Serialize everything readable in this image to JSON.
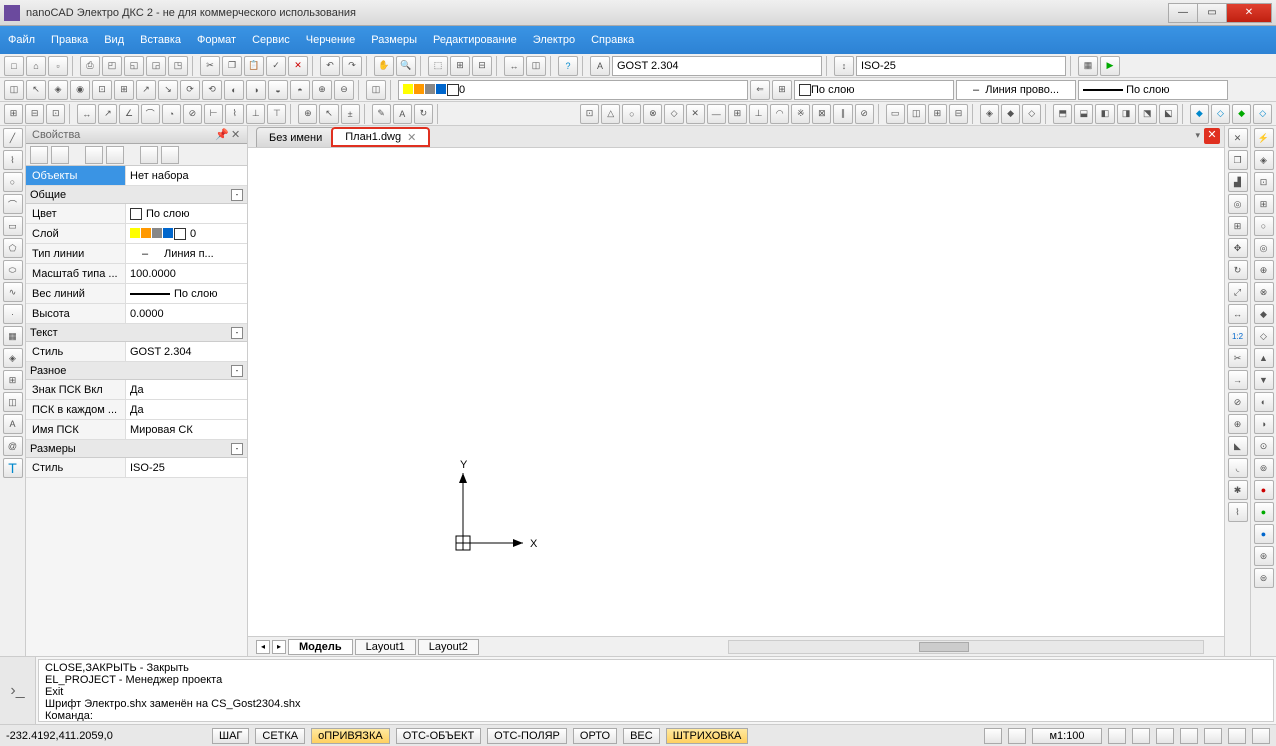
{
  "app": {
    "title": "nanoCAD Электро ДКС 2 - не для коммерческого использования"
  },
  "menu": [
    "Файл",
    "Правка",
    "Вид",
    "Вставка",
    "Формат",
    "Сервис",
    "Черчение",
    "Размеры",
    "Редактирование",
    "Электро",
    "Справка"
  ],
  "toolbar1": {
    "text_style": "GOST 2.304",
    "dim_style": "ISO-25"
  },
  "toolbar2": {
    "layer": "0",
    "color_label": "По слою",
    "linetype": "Линия прово...",
    "lineweight": "По слою",
    "dash": "–"
  },
  "docs": {
    "tab1": "Без имени",
    "tab2": "План1.dwg"
  },
  "props": {
    "panel_title": "Свойства",
    "objects_key": "Объекты",
    "objects_val": "Нет набора",
    "sec_general": "Общие",
    "color_key": "Цвет",
    "color_val": "По слою",
    "layer_key": "Слой",
    "layer_val": "0",
    "linetype_key": "Тип линии",
    "linetype_val": "Линия п...",
    "ltscale_key": "Масштаб типа ...",
    "ltscale_val": "100.0000",
    "lw_key": "Вес линий",
    "lw_val": "По слою",
    "height_key": "Высота",
    "height_val": "0.0000",
    "sec_text": "Текст",
    "style_key": "Стиль",
    "style_val": "GOST 2.304",
    "sec_misc": "Разное",
    "ucs_on_key": "Знак ПСК Вкл",
    "ucs_on_val": "Да",
    "ucs_each_key": "ПСК в каждом ...",
    "ucs_each_val": "Да",
    "ucs_name_key": "Имя ПСК",
    "ucs_name_val": "Мировая СК",
    "sec_dims": "Размеры",
    "dim_style_key": "Стиль",
    "dim_style_val": "ISO-25",
    "linetype_dash": "–"
  },
  "layouts": {
    "model": "Модель",
    "l1": "Layout1",
    "l2": "Layout2"
  },
  "command": {
    "line1": "CLOSE,ЗАКРЫТЬ - Закрыть",
    "line2": "EL_PROJECT - Менеджер проекта",
    "line3": "Exit",
    "line4": "Шрифт Электро.shx заменён на CS_Gost2304.shx",
    "prompt": "Команда:"
  },
  "status": {
    "coords": "-232.4192,411.2059,0",
    "snap": "ШАГ",
    "grid": "СЕТКА",
    "osnap": "оПРИВЯЗКА",
    "otrack": "ОТС-ОБЪЕКТ",
    "polar": "ОТС-ПОЛЯР",
    "ortho": "ОРТО",
    "lwt": "ВЕС",
    "hatch": "ШТРИХОВКА",
    "scale": "м1:100"
  },
  "ucs_axes": {
    "x": "X",
    "y": "Y"
  },
  "ratio": "1:2"
}
